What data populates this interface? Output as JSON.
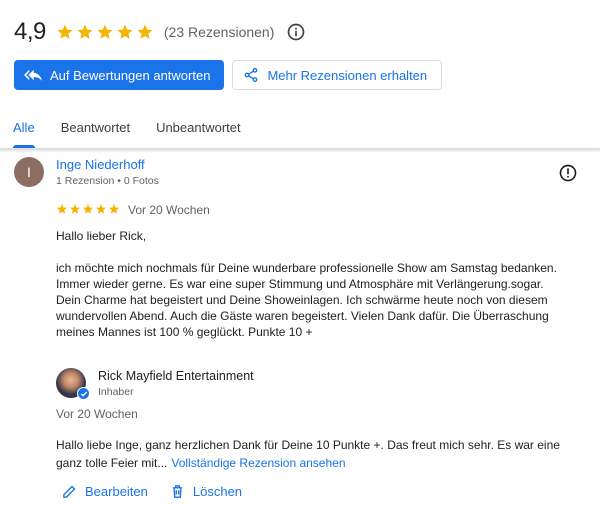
{
  "summary": {
    "rating": "4,9",
    "star_count": 5,
    "review_count": "(23 Rezensionen)",
    "star_color": "#f4b400"
  },
  "actions": {
    "reply_label": "Auf Bewertungen antworten",
    "more_label": "Mehr Rezensionen erhalten"
  },
  "tabs": [
    {
      "label": "Alle",
      "active": true
    },
    {
      "label": "Beantwortet",
      "active": false
    },
    {
      "label": "Unbeantwortet",
      "active": false
    }
  ],
  "review": {
    "avatar_letter": "I",
    "avatar_color": "#8d6e63",
    "reviewer": "Inge Niederhoff",
    "meta": "1 Rezension • 0 Fotos",
    "stars": 5,
    "date": "Vor 20 Wochen",
    "greeting": "Hallo lieber Rick,",
    "lines": [
      "ich möchte mich nochmals für Deine wunderbare professionelle Show am Samstag bedanken.",
      "Immer wieder gerne. Es war eine super Stimmung und Atmosphäre mit Verlängerung.sogar.",
      "Dein Charme hat begeistert und Deine Showeinlagen. Ich schwärme heute noch von diesem",
      "wundervollen Abend. Auch die Gäste waren begeistert. Vielen Dank dafür. Die Überraschung",
      "meines Mannes ist 100 % geglückt. Punkte 10 +"
    ]
  },
  "reply": {
    "owner_name": "Rick Mayfield Entertainment",
    "owner_role": "Inhaber",
    "date": "Vor 20 Wochen",
    "line1": "Hallo liebe Inge, ganz herzlichen Dank für Deine 10 Punkte +. Das freut mich sehr. Es war eine",
    "line2": "ganz tolle Feier mit...",
    "link": "Vollständige Rezension ansehen"
  },
  "bottom": {
    "edit_label": "Bearbeiten",
    "delete_label": "Löschen"
  },
  "colors": {
    "accent": "#1a73e8",
    "text": "#202124",
    "secondary": "#5f6368"
  }
}
